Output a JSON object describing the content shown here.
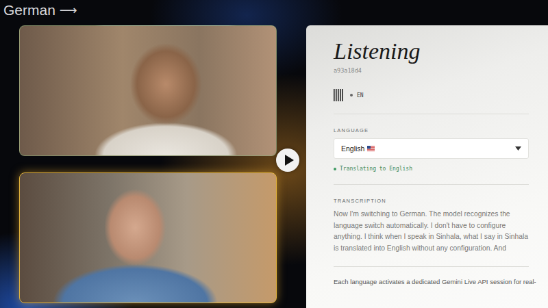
{
  "header": {
    "label": "German",
    "arrow": "⟶"
  },
  "videos": [
    {
      "highlighted": false
    },
    {
      "highlighted": true
    }
  ],
  "panel": {
    "status": "Listening",
    "session_id": "a93a18d4",
    "audio_indicator": {
      "label": "EN",
      "active": true
    },
    "language": {
      "label": "LANGUAGE",
      "value": "English"
    },
    "translation_status": {
      "text": "Translating to English",
      "active": true
    },
    "transcription": {
      "label": "TRANSCRIPTION",
      "text": "Now I'm switching to German. The model recognizes the language switch automatically. I don't have to configure anything. I think when I speak in Sinhala, what I say in Sinhala is translated into English without any configuration. And"
    },
    "footer_note": "Each language activates a dedicated Gemini Live API session for real-"
  }
}
